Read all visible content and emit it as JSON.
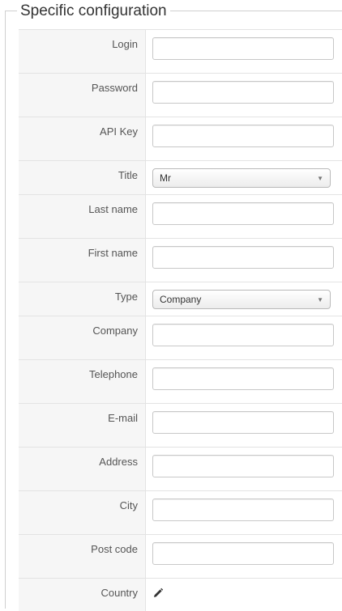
{
  "legend": "Specific configuration",
  "fields": {
    "login": {
      "label": "Login",
      "value": ""
    },
    "password": {
      "label": "Password",
      "value": ""
    },
    "api_key": {
      "label": "API Key",
      "value": ""
    },
    "title": {
      "label": "Title",
      "selected": "Mr"
    },
    "last_name": {
      "label": "Last name",
      "value": ""
    },
    "first_name": {
      "label": "First name",
      "value": ""
    },
    "type": {
      "label": "Type",
      "selected": "Company"
    },
    "company": {
      "label": "Company",
      "value": ""
    },
    "telephone": {
      "label": "Telephone",
      "value": ""
    },
    "email": {
      "label": "E-mail",
      "value": ""
    },
    "address": {
      "label": "Address",
      "value": ""
    },
    "city": {
      "label": "City",
      "value": ""
    },
    "post_code": {
      "label": "Post code",
      "value": ""
    },
    "country": {
      "label": "Country",
      "edit_icon": "pencil-icon"
    }
  }
}
